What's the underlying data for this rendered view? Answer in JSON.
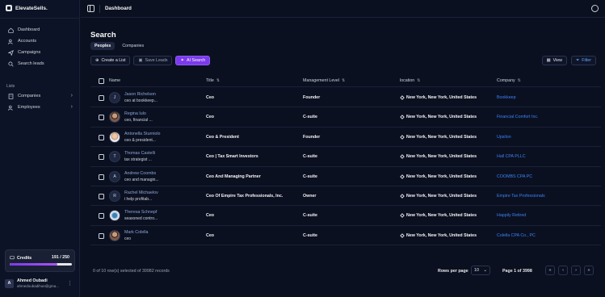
{
  "brand": {
    "name": "ElevateSells."
  },
  "sidebar": {
    "nav": [
      {
        "label": "Dashboard",
        "icon": "home-icon"
      },
      {
        "label": "Accounts",
        "icon": "users-icon"
      },
      {
        "label": "Campaigns",
        "icon": "send-icon"
      },
      {
        "label": "Search leads",
        "icon": "search-icon"
      }
    ],
    "lists_label": "Lists",
    "lists": [
      {
        "label": "Companies",
        "icon": "building-icon"
      },
      {
        "label": "Employees",
        "icon": "users-icon"
      }
    ],
    "credits": {
      "label": "Credits",
      "count": "191 / 250",
      "used": 191,
      "total": 250,
      "bar_colors": [
        "#7c3aed",
        "#a855f7"
      ]
    },
    "user": {
      "initial": "A",
      "name": "Ahmed Oubadi",
      "email": "ahmedoubadihoe@gma..."
    }
  },
  "topbar": {
    "title": "Dashboard"
  },
  "main": {
    "title": "Search",
    "tabs": [
      {
        "label": "Peoples",
        "active": true
      },
      {
        "label": "Companies",
        "active": false
      }
    ],
    "actions": {
      "create_list": "Create a List",
      "save_leads": "Save Leads",
      "ai_search": "AI Search",
      "view": "View",
      "filter": "Filter"
    },
    "columns": {
      "name": "Name",
      "title": "Title",
      "level": "Management Level",
      "location": "location",
      "company": "Company"
    },
    "rows": [
      {
        "initial": "J",
        "name": "Jason Richelson",
        "sub": "ceo at bookkeep...",
        "title": "Ceo",
        "level": "Founder",
        "location": "New York, New York, United States",
        "company": "Bookkeep"
      },
      {
        "initial": "",
        "name": "Regina Iulo",
        "sub": "ceo, financial ...",
        "title": "Ceo",
        "level": "C-suite",
        "location": "New York, New York, United States",
        "company": "Financial Comfort Inc."
      },
      {
        "initial": "",
        "name": "Antonella Sturniolo",
        "sub": "ceo & president...",
        "title": "Ceo & President",
        "level": "Founder",
        "location": "New York, New York, United States",
        "company": "Upsilon"
      },
      {
        "initial": "T",
        "name": "Thomas Castelli",
        "sub": "tax strategist ...",
        "title": "Ceo | Tax Smart Investors",
        "level": "C-suite",
        "location": "New York, New York, United States",
        "company": "Hall CPA PLLC"
      },
      {
        "initial": "A",
        "name": "Andrew Coombs",
        "sub": "ceo and managin...",
        "title": "Ceo And Managing Partner",
        "level": "C-suite",
        "location": "New York, New York, United States",
        "company": "COOMBS CPA PC"
      },
      {
        "initial": "R",
        "name": "Rachel Michaelov",
        "sub": "i help profitab...",
        "title": "Ceo Of Empire Tax Professionals, Inc.",
        "level": "Owner",
        "location": "New York, New York, United States",
        "company": "Empire Tax Professionals"
      },
      {
        "initial": "",
        "name": "Theresa Schnepf",
        "sub": "seasoned contro...",
        "title": "Ceo",
        "level": "C-suite",
        "location": "New York, New York, United States",
        "company": "Happily Retired"
      },
      {
        "initial": "",
        "name": "Mark Colella",
        "sub": "ceo",
        "title": "Ceo",
        "level": "C-suite",
        "location": "New York, New York, United States",
        "company": "Colella CPA Co., PC"
      }
    ],
    "footer": {
      "selection": "0 of 10 row(s) selected of 39982 records",
      "rows_per_page_label": "Rows per page",
      "rows_per_page": "10",
      "page_info": "Page 1 of 3998"
    }
  }
}
